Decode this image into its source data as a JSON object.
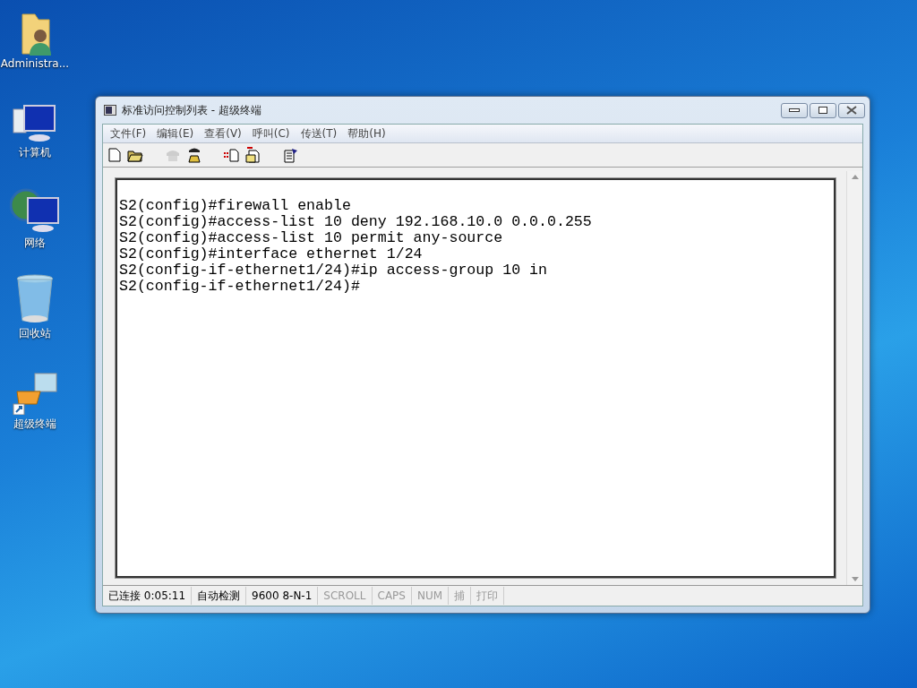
{
  "desktop_icons": [
    {
      "label": "Administra...",
      "kind": "user-folder"
    },
    {
      "label": "计算机",
      "kind": "computer"
    },
    {
      "label": "网络",
      "kind": "network"
    },
    {
      "label": "回收站",
      "kind": "recycle-bin"
    },
    {
      "label": "超级终端",
      "kind": "terminal-shortcut"
    }
  ],
  "window": {
    "title": "标准访问控制列表 - 超级终端",
    "menu": [
      "文件(F)",
      "编辑(E)",
      "查看(V)",
      "呼叫(C)",
      "传送(T)",
      "帮助(H)"
    ],
    "toolbar": [
      {
        "kind": "new",
        "disabled": false
      },
      {
        "kind": "open",
        "disabled": false
      },
      {
        "kind": "call",
        "disabled": true
      },
      {
        "kind": "hangup",
        "disabled": false
      },
      {
        "kind": "send",
        "disabled": false
      },
      {
        "kind": "receive",
        "disabled": false
      },
      {
        "kind": "properties",
        "disabled": false
      }
    ],
    "terminal_lines": [
      "S2(config)#firewall enable",
      "S2(config)#access-list 10 deny 192.168.10.0 0.0.0.255",
      "S2(config)#access-list 10 permit any-source",
      "S2(config)#interface ethernet 1/24",
      "S2(config-if-ethernet1/24)#ip access-group 10 in",
      "S2(config-if-ethernet1/24)#"
    ],
    "status_bar": [
      {
        "text": "已连接 0:05:11",
        "disabled": false
      },
      {
        "text": "自动检测",
        "disabled": false
      },
      {
        "text": "9600 8-N-1",
        "disabled": false
      },
      {
        "text": "SCROLL",
        "disabled": true
      },
      {
        "text": "CAPS",
        "disabled": true
      },
      {
        "text": "NUM",
        "disabled": true
      },
      {
        "text": "捕",
        "disabled": true
      },
      {
        "text": "打印",
        "disabled": true
      }
    ]
  }
}
